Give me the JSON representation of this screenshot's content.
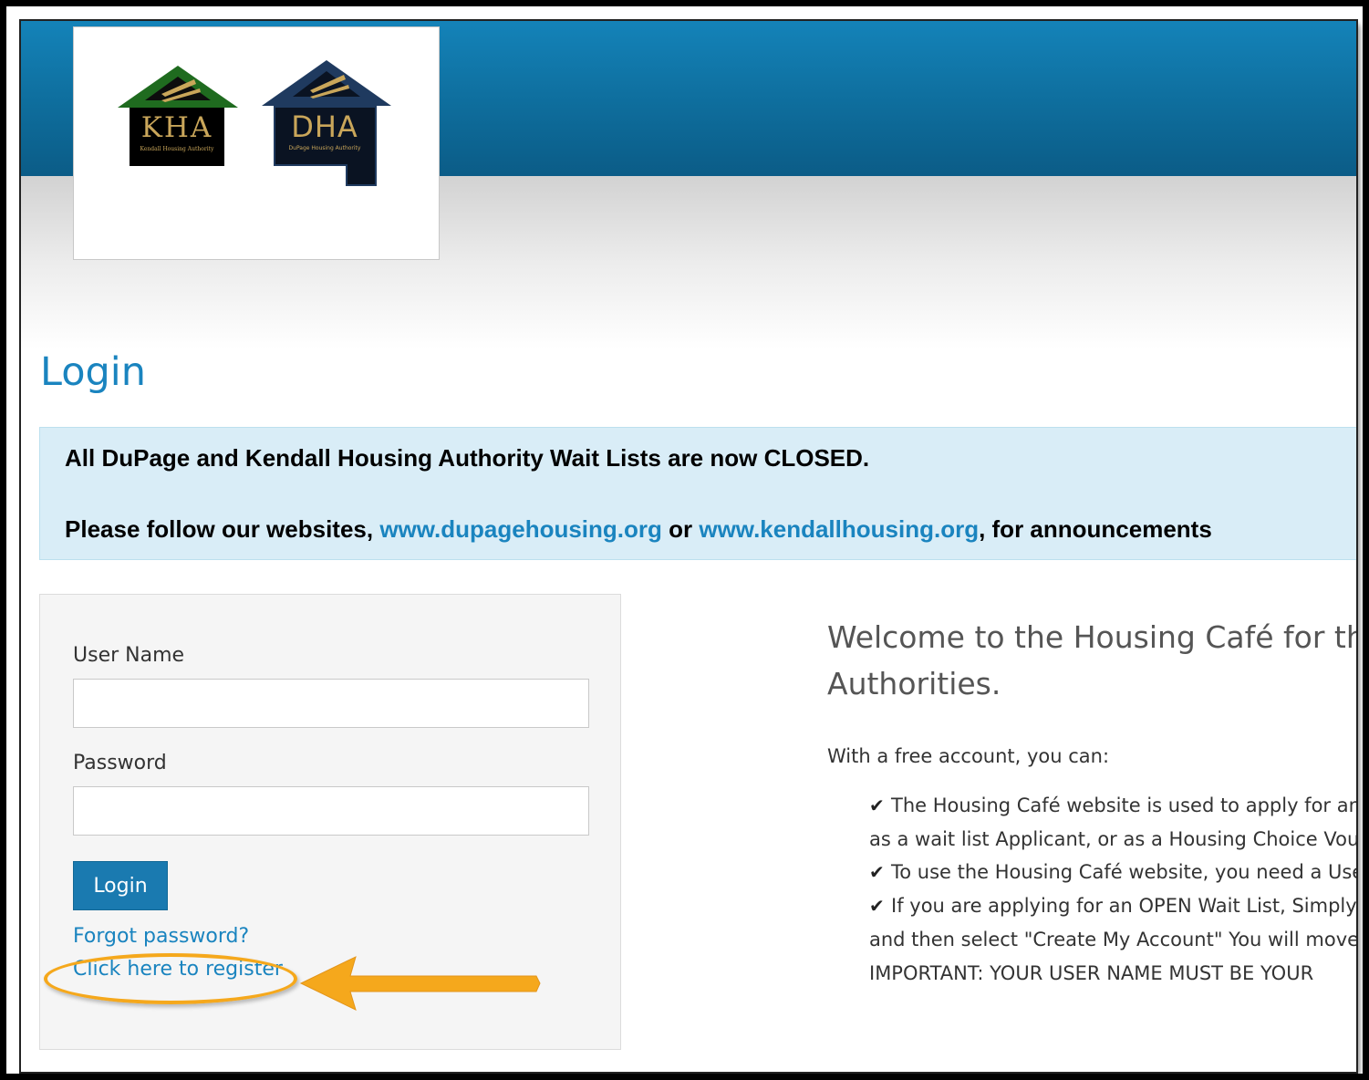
{
  "logos": {
    "kha": {
      "letters": "KHA",
      "subtitle": "Kendall Housing Authority",
      "color": "#1f6b1f"
    },
    "dha": {
      "letters": "DHA",
      "subtitle": "DuPage Housing Authority",
      "color": "#1f3a5f"
    }
  },
  "page_title": "Login",
  "alert": {
    "line1": "All DuPage and Kendall Housing Authority Wait Lists are now CLOSED.",
    "line2_prefix": "Please follow our websites, ",
    "link1": "www.dupagehousing.org",
    "line2_mid": " or ",
    "link2": "www.kendallhousing.org",
    "line2_suffix": ", for announcements"
  },
  "login_form": {
    "username_label": "User Name",
    "username_value": "",
    "password_label": "Password",
    "password_value": "",
    "login_button": "Login",
    "forgot_link": "Forgot password?",
    "register_link": "Click here to register"
  },
  "welcome": {
    "heading": "Welcome to the Housing Café for the Authorities.",
    "subhead": "With a free account, you can:",
    "lines": [
      "The Housing Café website is used to apply for an",
      "as a wait list Applicant, or as a Housing Choice Vouc",
      "To use the Housing Café website, you need a Use",
      "If you are applying for an OPEN Wait List, Simply",
      "and then select \"Create My Account\" You will move",
      "IMPORTANT: YOUR USER NAME MUST BE YOUR"
    ]
  },
  "colors": {
    "accent": "#1a84bf",
    "header": "#0e6d9c",
    "alert_bg": "#d9edf7",
    "annotation": "#f5a81c"
  }
}
